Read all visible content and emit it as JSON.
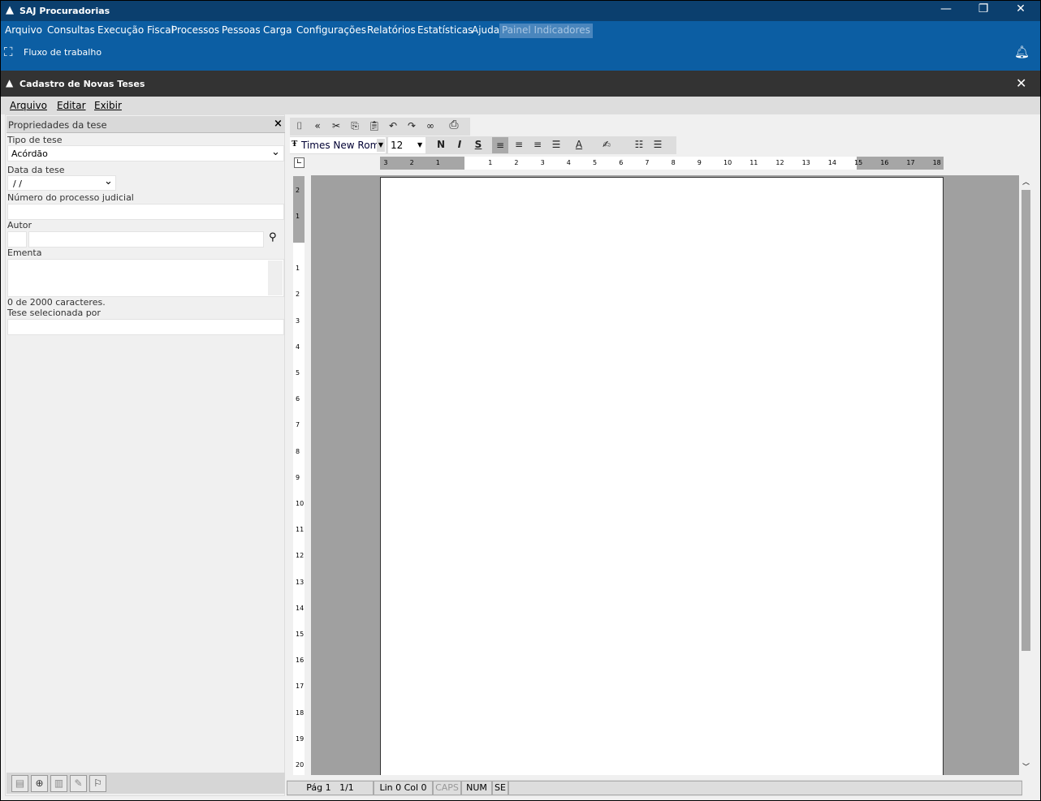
{
  "app": {
    "title": "SAJ Procuradorias",
    "minimize": "—",
    "restore": "❐",
    "close": "✕"
  },
  "menu": [
    "Arquivo",
    "Consultas",
    "Execução Fiscal",
    "Processos",
    "Pessoas",
    "Carga",
    "Configurações",
    "Relatórios",
    "Estatísticas",
    "Ajuda"
  ],
  "menu_disabled": "Painel Indicadores",
  "toolbar": {
    "flow_label": "Fluxo de trabalho"
  },
  "window": {
    "title": "Cadastro de Novas Teses",
    "close": "✕"
  },
  "inner_menu": [
    "Arquivo",
    "Editar",
    "Exibir"
  ],
  "panel": {
    "title": "Propriedades da tese",
    "close": "×",
    "tipo_label": "Tipo de tese",
    "tipo_value": "Acórdão",
    "data_label": "Data da tese",
    "data_value": " /  /",
    "numero_label": "Número do processo judicial",
    "autor_label": "Autor",
    "ementa_label": "Ementa",
    "char_count": "0 de 2000 caracteres.",
    "selecionada_label": "Tese selecionada por"
  },
  "editor": {
    "font": "Times New Roma",
    "size": "12",
    "bold": "N",
    "italic": "I",
    "strike": "S"
  },
  "ruler": {
    "h_neg": [
      "3",
      "2",
      "1"
    ],
    "h_pos": [
      "1",
      "2",
      "3",
      "4",
      "5",
      "6",
      "7",
      "8",
      "9",
      "10",
      "11",
      "12",
      "13",
      "14",
      "15",
      "16",
      "17",
      "18"
    ],
    "v_neg": [
      "2",
      "1"
    ],
    "v_pos": [
      "1",
      "2",
      "3",
      "4",
      "5",
      "6",
      "7",
      "8",
      "9",
      "10",
      "11",
      "12",
      "13",
      "14",
      "15",
      "16",
      "17",
      "18",
      "19",
      "20"
    ]
  },
  "status": {
    "page": "Pág 1",
    "pages": "1/1",
    "pos": "Lin 0  Col 0",
    "caps": "CAPS",
    "num": "NUM",
    "se": "SE"
  }
}
